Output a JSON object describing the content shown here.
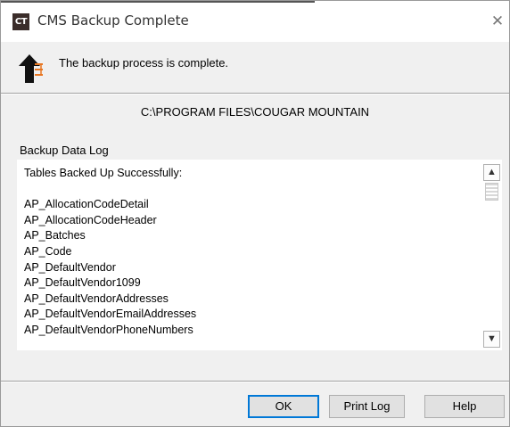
{
  "window": {
    "app_icon_text": "CT",
    "title": "CMS Backup Complete",
    "close_glyph": "✕"
  },
  "message": {
    "icon": "upload-arrow-icon",
    "text": "The backup process is complete."
  },
  "path": "C:\\PROGRAM FILES\\COUGAR MOUNTAIN",
  "log": {
    "label": "Backup Data Log",
    "lines": [
      "Tables Backed Up Successfully:",
      "",
      "AP_AllocationCodeDetail",
      "AP_AllocationCodeHeader",
      "AP_Batches",
      "AP_Code",
      "AP_DefaultVendor",
      "AP_DefaultVendor1099",
      "AP_DefaultVendorAddresses",
      "AP_DefaultVendorEmailAddresses",
      "AP_DefaultVendorPhoneNumbers"
    ],
    "scroll_up_glyph": "▲",
    "scroll_down_glyph": "▼"
  },
  "buttons": {
    "ok": "OK",
    "print_log": "Print Log",
    "help": "Help"
  },
  "colors": {
    "focus_border": "#0078d7",
    "app_icon_bg": "#3b2d2a",
    "arrow_orange": "#e87722"
  }
}
